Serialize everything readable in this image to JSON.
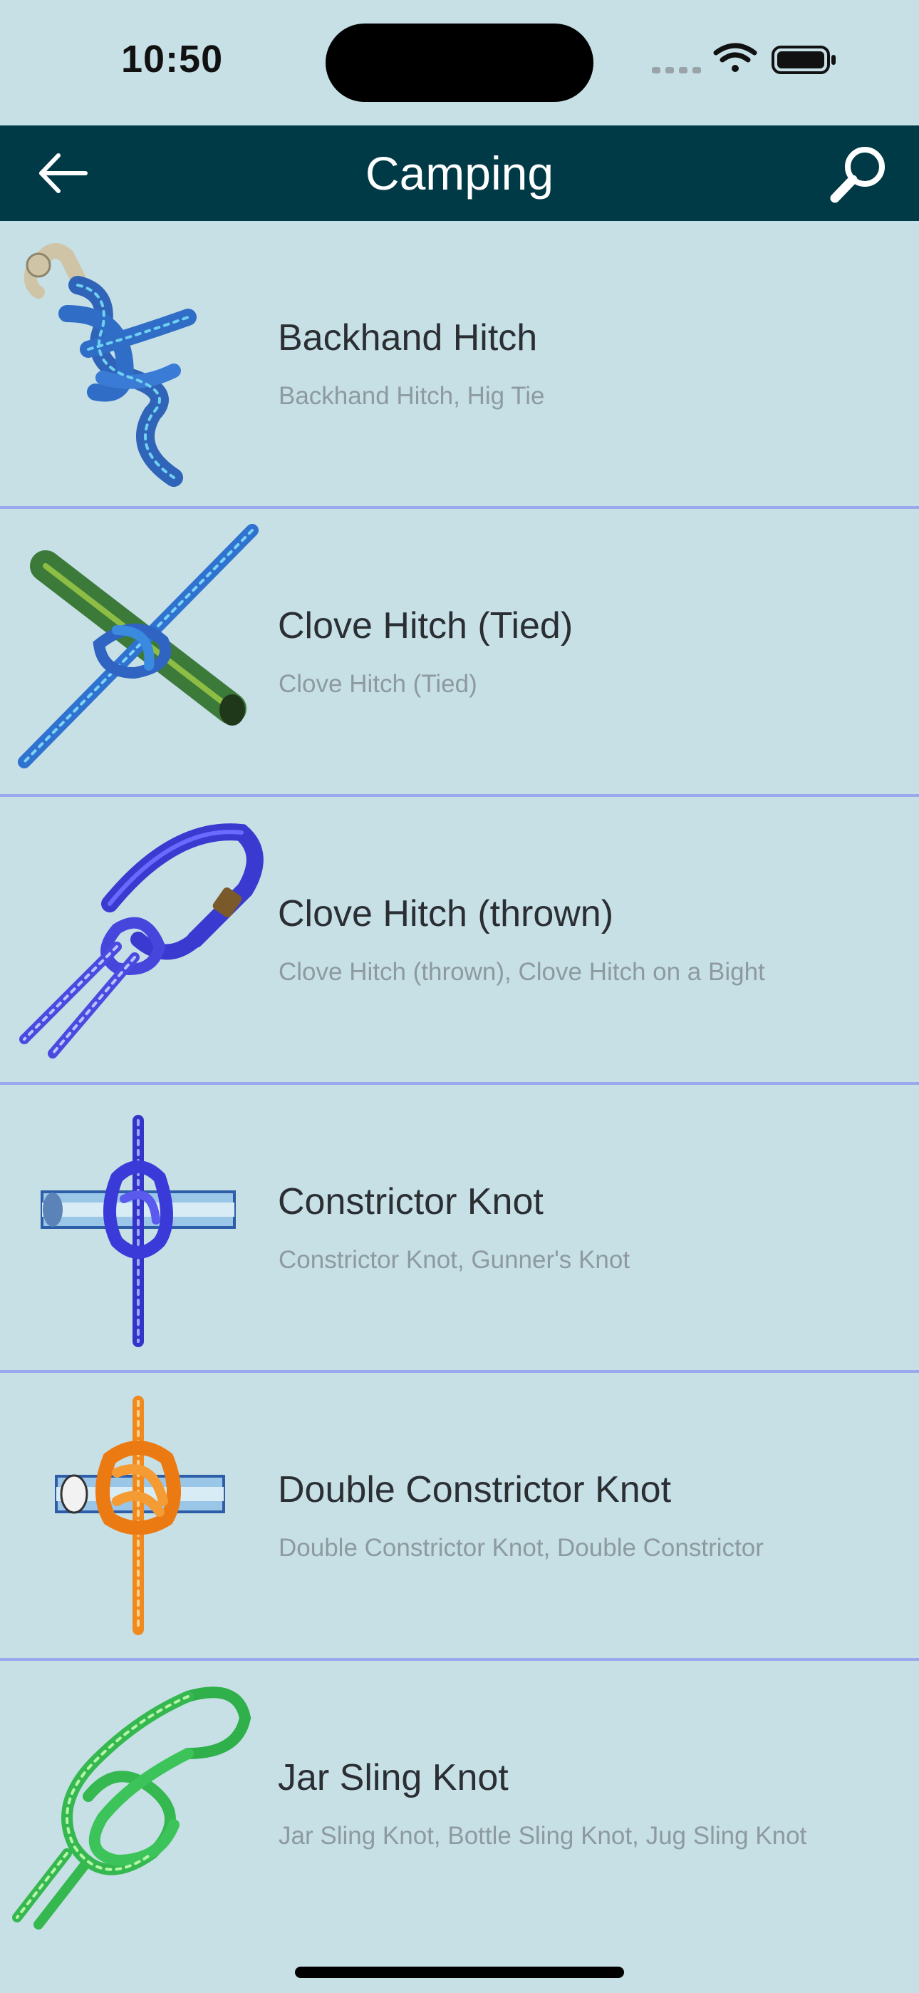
{
  "status_bar": {
    "time": "10:50",
    "icons": [
      "cellular-icon",
      "wifi-icon",
      "battery-icon"
    ]
  },
  "nav": {
    "title": "Camping",
    "back_icon": "back-arrow-icon",
    "search_icon": "search-icon"
  },
  "colors": {
    "background": "#c6e0e6",
    "nav_background": "#003a46",
    "divider": "#9aa8ee"
  },
  "knots": [
    {
      "title": "Backhand Hitch",
      "subtitle": "Backhand Hitch, Hig Tie",
      "icon": "backhand-hitch-knot-icon"
    },
    {
      "title": "Clove Hitch (Tied)",
      "subtitle": "Clove Hitch (Tied)",
      "icon": "clove-hitch-tied-knot-icon"
    },
    {
      "title": "Clove Hitch (thrown)",
      "subtitle": "Clove Hitch (thrown), Clove Hitch on a Bight",
      "icon": "clove-hitch-thrown-knot-icon"
    },
    {
      "title": "Constrictor Knot",
      "subtitle": "Constrictor Knot, Gunner's Knot",
      "icon": "constrictor-knot-icon"
    },
    {
      "title": "Double Constrictor Knot",
      "subtitle": "Double Constrictor Knot, Double Constrictor",
      "icon": "double-constrictor-knot-icon"
    },
    {
      "title": "Jar Sling Knot",
      "subtitle": "Jar Sling Knot, Bottle Sling Knot, Jug Sling Knot",
      "icon": "jar-sling-knot-icon"
    }
  ]
}
